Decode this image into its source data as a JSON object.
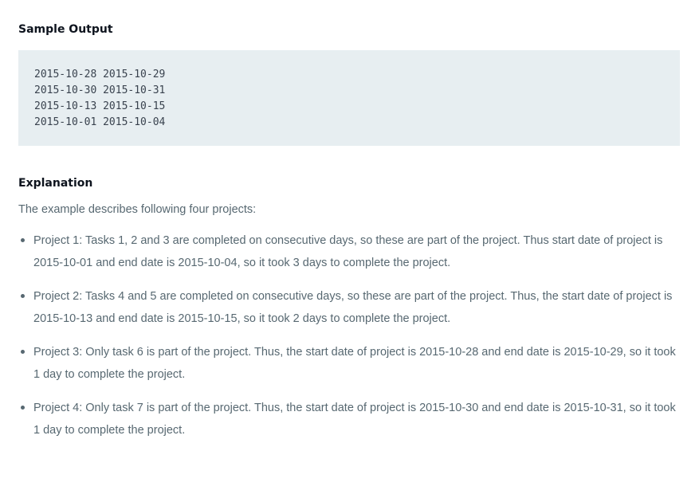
{
  "sample_output": {
    "heading": "Sample Output",
    "lines": [
      "2015-10-28 2015-10-29",
      "2015-10-30 2015-10-31",
      "2015-10-13 2015-10-15",
      "2015-10-01 2015-10-04"
    ]
  },
  "explanation": {
    "heading": "Explanation",
    "intro": "The example describes following four projects:",
    "items": [
      "Project 1: Tasks 1, 2 and 3 are completed on consecutive days, so these are part of the project. Thus start date of project is 2015-10-01 and end date is 2015-10-04, so it took 3 days to complete the project.",
      "Project 2: Tasks 4 and 5 are completed on consecutive days, so these are part of the project. Thus, the start date of project is 2015-10-13 and end date is 2015-10-15, so it took 2 days to complete the project.",
      "Project 3: Only task 6 is part of the project. Thus, the start date of project is 2015-10-28 and end date is 2015-10-29, so it took 1 day to complete the project.",
      "Project 4: Only task 7 is part of the project. Thus, the start date of project is 2015-10-30 and end date is 2015-10-31, so it took 1 day to complete the project."
    ]
  }
}
